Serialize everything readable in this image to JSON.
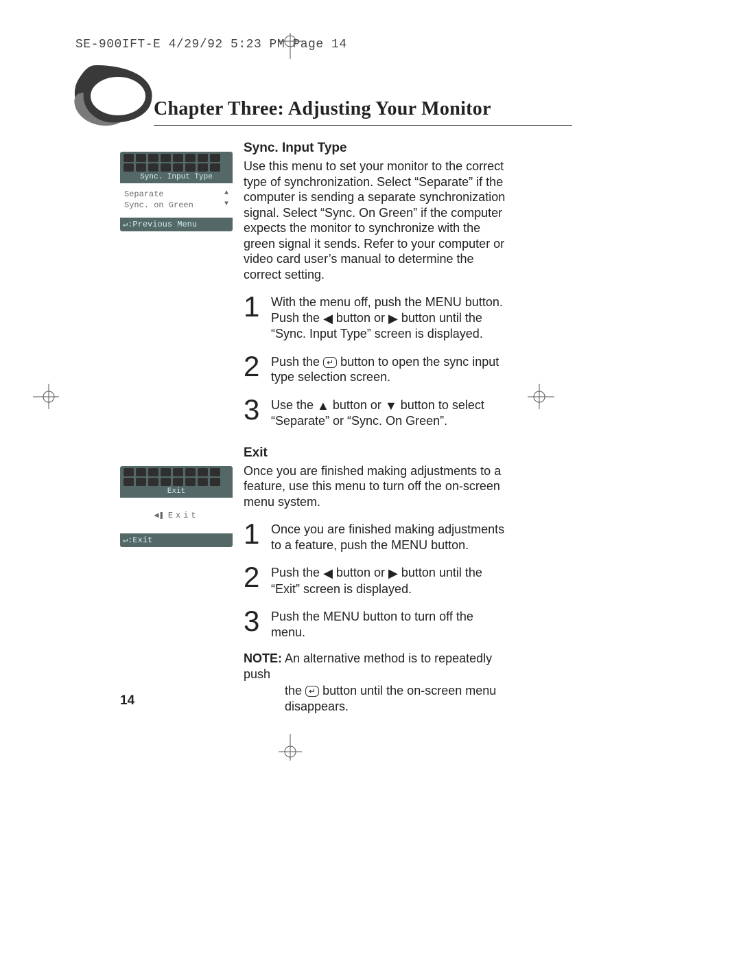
{
  "slug": "SE-900IFT-E  4/29/92 5:23 PM  Page 14",
  "chapter_title": "Chapter Three: Adjusting Your Monitor",
  "sync": {
    "heading": "Sync. Input Type",
    "paragraph": "Use this menu to set your monitor to the correct type of synchronization. Select “Separate” if the computer is sending a separate synchronization signal. Select “Sync. On Green” if the computer expects the monitor to synchronize with the green signal it sends. Refer to your computer or video card user’s manual to determine the correct setting.",
    "osd_title": "Sync. Input Type",
    "osd_option1": "Separate",
    "osd_option2": "Sync. on Green",
    "osd_footer": ":Previous Menu",
    "step1_a": "With the menu off, push the MENU button. Push the ",
    "step1_b": " button or ",
    "step1_c": " button until the “Sync. Input Type” screen is displayed.",
    "step2_a": "Push the ",
    "step2_b": " button to open the sync input type selection screen.",
    "step3_a": "Use the ",
    "step3_b": " button or ",
    "step3_c": " button to select “Separate” or “Sync. On Green”."
  },
  "exit": {
    "heading": "Exit",
    "paragraph": "Once you are finished making adjustments to a feature, use this menu to turn off the on-screen menu system.",
    "osd_title": "Exit",
    "osd_body": "Exit",
    "osd_footer": ":Exit",
    "step1": "Once you are finished making adjustments to a feature, push the MENU button.",
    "step2_a": "Push the ",
    "step2_b": " button or ",
    "step2_c": " button until the “Exit” screen is displayed.",
    "step3": "Push the MENU button to turn off the menu."
  },
  "note": {
    "label": "NOTE:",
    "line1": " An alternative method is to repeatedly push",
    "line2_a": "the ",
    "line2_b": " button until the on-screen menu disappears."
  },
  "glyph": {
    "left": "◀",
    "right": "▶",
    "up": "▲",
    "down": "▼",
    "enter": "↵",
    "plug": "◀❚"
  },
  "nums": {
    "one": "1",
    "two": "2",
    "three": "3"
  },
  "page_number": "14"
}
